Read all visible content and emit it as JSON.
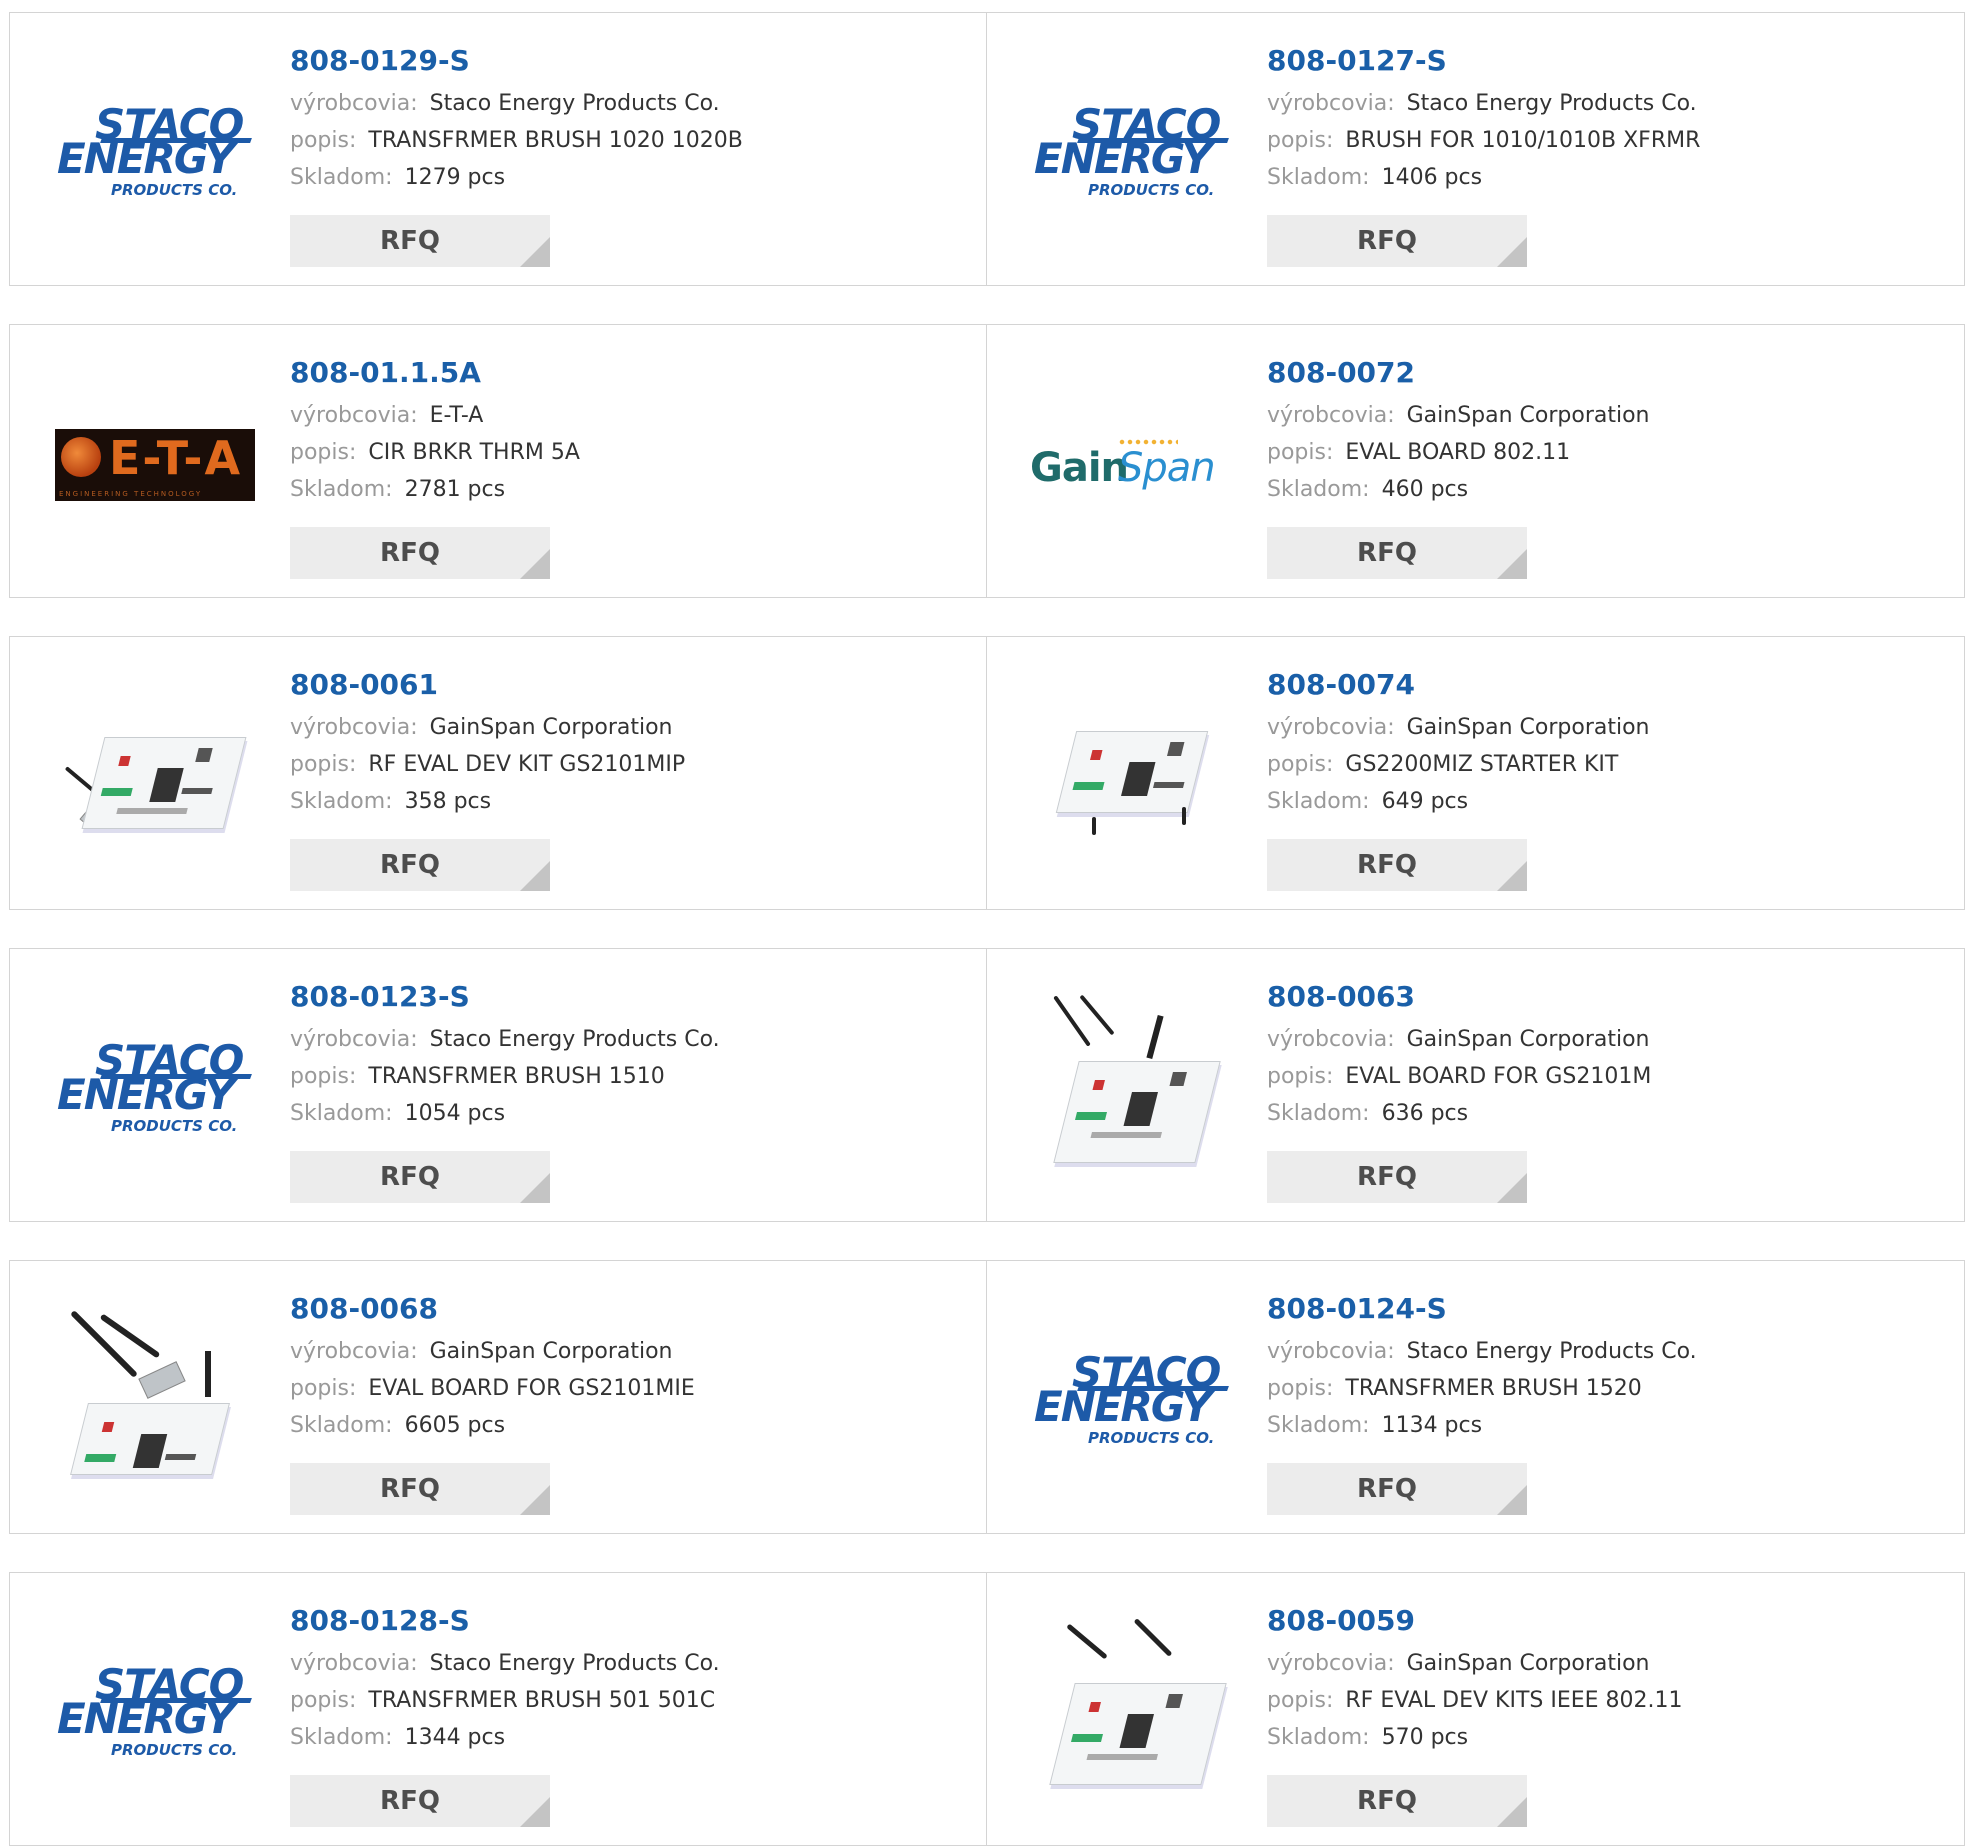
{
  "labels": {
    "manufacturer": "výrobcovia:",
    "description": "popis:",
    "stock": "Skladom:",
    "rfq": "RFQ"
  },
  "logos": {
    "staco": {
      "line1": "STACO",
      "line2": "ENERGY",
      "line3": "PRODUCTS CO."
    },
    "eta": {
      "text": "E-T-A",
      "sub": "ENGINEERING TECHNOLOGY"
    },
    "gainspan": {
      "part1": "Gain",
      "part2": "Span"
    }
  },
  "colors": {
    "part_link": "#1a5fa8",
    "label_gray": "#999999",
    "rfq_bg": "#ececec",
    "staco_blue": "#1d5aa8",
    "eta_orange": "#e06a1e"
  },
  "products": [
    {
      "part": "808-0129-S",
      "manufacturer": "Staco Energy Products Co.",
      "description": "TRANSFRMER BRUSH 1020 1020B",
      "stock": "1279 pcs",
      "image": "staco-logo"
    },
    {
      "part": "808-0127-S",
      "manufacturer": "Staco Energy Products Co.",
      "description": "BRUSH FOR 1010/1010B XFRMR",
      "stock": "1406 pcs",
      "image": "staco-logo"
    },
    {
      "part": "808-01.1.5A",
      "manufacturer": "E-T-A",
      "description": "CIR BRKR THRM 5A",
      "stock": "2781 pcs",
      "image": "eta-logo"
    },
    {
      "part": "808-0072",
      "manufacturer": "GainSpan Corporation",
      "description": "EVAL BOARD 802.11",
      "stock": "460 pcs",
      "image": "gainspan-logo"
    },
    {
      "part": "808-0061",
      "manufacturer": "GainSpan Corporation",
      "description": "RF EVAL DEV KIT GS2101MIP",
      "stock": "358 pcs",
      "image": "board-photo"
    },
    {
      "part": "808-0074",
      "manufacturer": "GainSpan Corporation",
      "description": "GS2200MIZ STARTER KIT",
      "stock": "649 pcs",
      "image": "board-photo"
    },
    {
      "part": "808-0123-S",
      "manufacturer": "Staco Energy Products Co.",
      "description": "TRANSFRMER BRUSH 1510",
      "stock": "1054 pcs",
      "image": "staco-logo"
    },
    {
      "part": "808-0063",
      "manufacturer": "GainSpan Corporation",
      "description": "EVAL BOARD FOR GS2101M",
      "stock": "636 pcs",
      "image": "board-photo"
    },
    {
      "part": "808-0068",
      "manufacturer": "GainSpan Corporation",
      "description": "EVAL BOARD FOR GS2101MIE",
      "stock": "6605 pcs",
      "image": "board-photo"
    },
    {
      "part": "808-0124-S",
      "manufacturer": "Staco Energy Products Co.",
      "description": "TRANSFRMER BRUSH 1520",
      "stock": "1134 pcs",
      "image": "staco-logo"
    },
    {
      "part": "808-0128-S",
      "manufacturer": "Staco Energy Products Co.",
      "description": "TRANSFRMER BRUSH 501 501C",
      "stock": "1344 pcs",
      "image": "staco-logo"
    },
    {
      "part": "808-0059",
      "manufacturer": "GainSpan Corporation",
      "description": "RF EVAL DEV KITS IEEE 802.11",
      "stock": "570 pcs",
      "image": "board-photo"
    }
  ]
}
